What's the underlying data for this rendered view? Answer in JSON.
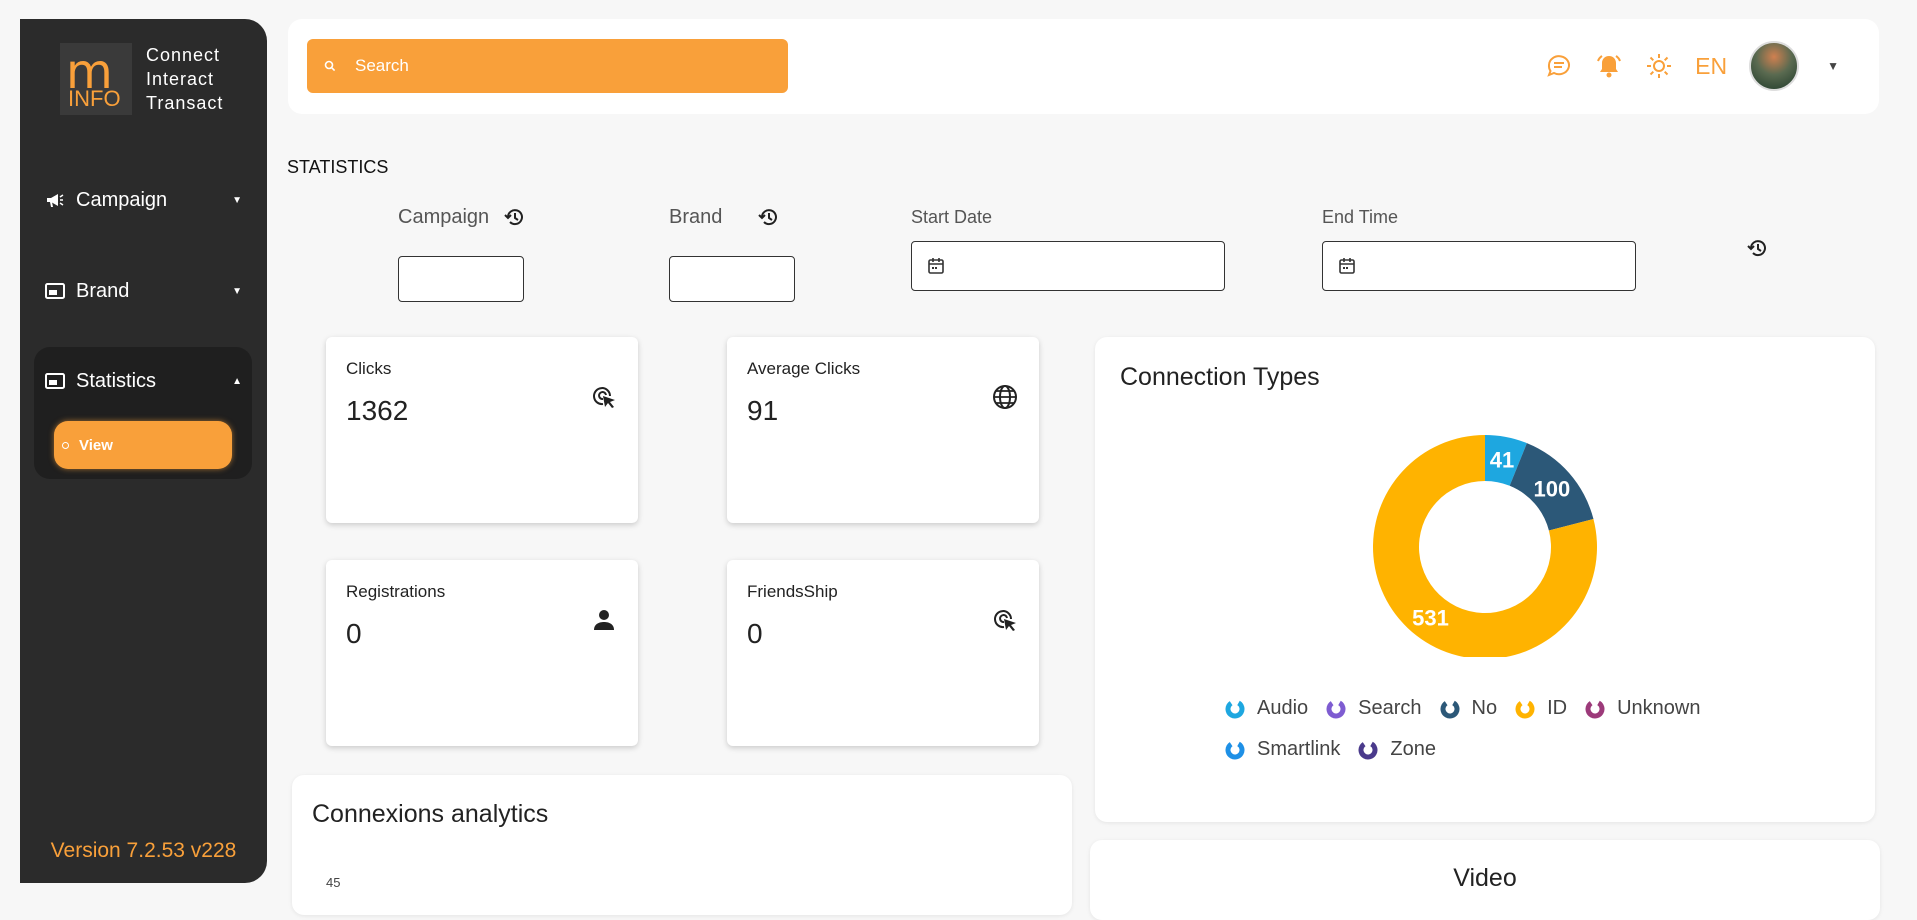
{
  "brand": {
    "logo_m": "m",
    "logo_info": "INFO",
    "tagline": [
      "Connect",
      "Interact",
      "Transact"
    ]
  },
  "sidebar": {
    "items": [
      {
        "label": "Campaign"
      },
      {
        "label": "Brand"
      },
      {
        "label": "Statistics"
      }
    ],
    "sub_view": "View",
    "version": "Version 7.2.53 v228"
  },
  "topbar": {
    "search_placeholder": "Search",
    "lang": "EN"
  },
  "page": {
    "title": "STATISTICS"
  },
  "filters": {
    "campaign": "Campaign",
    "brand": "Brand",
    "start_date": "Start Date",
    "end_time": "End Time"
  },
  "cards": [
    {
      "label": "Clicks",
      "value": "1362",
      "icon": "cursor-click-icon"
    },
    {
      "label": "Average Clicks",
      "value": "91",
      "icon": "globe-icon"
    },
    {
      "label": "Registrations",
      "value": "0",
      "icon": "person-icon"
    },
    {
      "label": "FriendsShip",
      "value": "0",
      "icon": "cursor-click-icon"
    }
  ],
  "connexions": {
    "title": "Connexions analytics",
    "first_tick": "45"
  },
  "video": {
    "title": "Video"
  },
  "chart_data": {
    "type": "pie",
    "title": "Connection Types",
    "donut": true,
    "series": [
      {
        "name": "Audio",
        "value": 41,
        "color": "#1ea7e0"
      },
      {
        "name": "Search",
        "value": 0,
        "color": "#7e5cd1"
      },
      {
        "name": "No",
        "value": 100,
        "color": "#2c5878"
      },
      {
        "name": "ID",
        "value": 531,
        "color": "#ffb300"
      },
      {
        "name": "Unknown",
        "value": 0,
        "color": "#9c3a7a"
      },
      {
        "name": "Smartlink",
        "value": 0,
        "color": "#1e90e6"
      },
      {
        "name": "Zone",
        "value": 0,
        "color": "#4a3a8c"
      }
    ],
    "legend": "bottom"
  },
  "colors": {
    "accent": "#f9a03a",
    "sidebar": "#2b2b2b"
  }
}
